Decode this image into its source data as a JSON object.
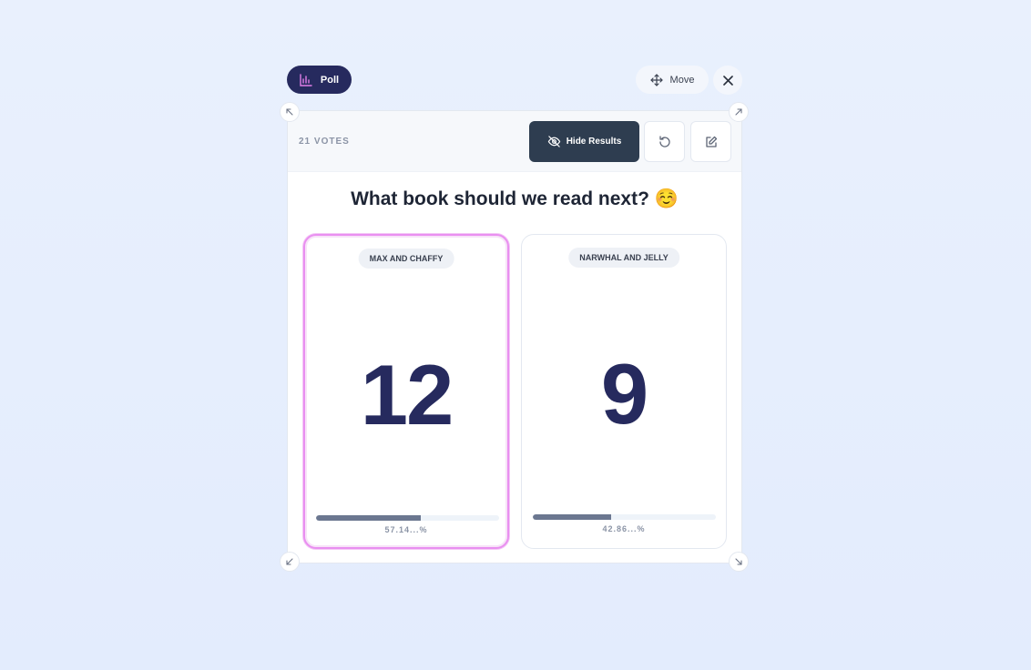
{
  "toolbar": {
    "poll_label": "Poll",
    "move_label": "Move"
  },
  "poll": {
    "votes_label": "21 VOTES",
    "hide_results_label": "Hide Results",
    "question": "What book should we read next? ☺️",
    "options": [
      {
        "label": "MAX AND CHAFFY",
        "count": "12",
        "percent_text": "57.14...%",
        "fraction": 0.5714,
        "selected": true
      },
      {
        "label": "NARWHAL AND JELLY",
        "count": "9",
        "percent_text": "42.86...%",
        "fraction": 0.4286,
        "selected": false
      }
    ]
  },
  "colors": {
    "accent_dark": "#262a5e",
    "button_dark": "#2e3d50",
    "selected_border": "#e98ff0",
    "bar_fill": "#6b7790",
    "poll_icon": "#e07ee8"
  },
  "icons": {
    "poll": "bar-chart-icon",
    "move": "move-arrows-icon",
    "close": "close-icon",
    "hide": "eye-off-icon",
    "reset": "reset-icon",
    "edit": "edit-icon",
    "resize": "resize-arrow-icon"
  }
}
